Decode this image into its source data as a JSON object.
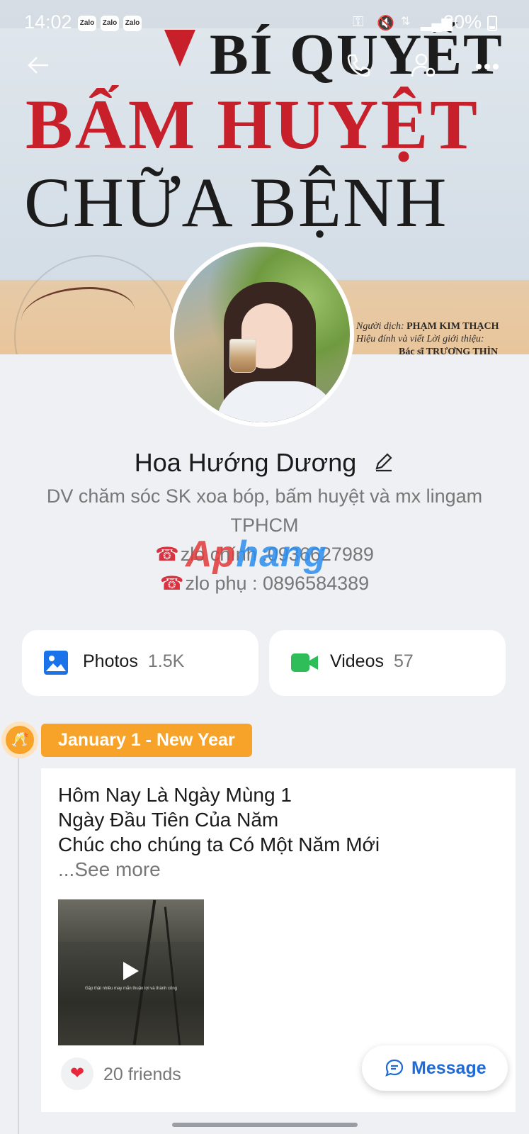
{
  "status_bar": {
    "time": "14:02",
    "notification_icons": [
      "Zalo",
      "Zalo",
      "Zalo"
    ],
    "battery": "20%"
  },
  "cover": {
    "line1": "BÍ QUYẾT",
    "line2": "BẤM HUYỆT",
    "line3": "CHỮA BỆNH",
    "credit_translator_label": "Người dịch:",
    "credit_translator": "PHẠM KIM THẠCH",
    "credit_editor_label": "Hiệu đính và viết Lời giới thiệu:",
    "credit_editor": "Bác sĩ TRƯƠNG THÌN"
  },
  "profile": {
    "name": "Hoa Hướng Dương",
    "bio_line1": "DV chăm sóc SK xoa bóp, bấm huyệt và mx lingam TPHCM",
    "bio_line2": "zlo chính :0936627989",
    "bio_line3": "zlo phụ : 0896584389"
  },
  "watermark": {
    "part1": "Ap",
    "part2": "hang"
  },
  "media": {
    "photos_label": "Photos",
    "photos_count": "1.5K",
    "videos_label": "Videos",
    "videos_count": "57"
  },
  "timeline": {
    "event_tag": "January 1 - New Year",
    "post_line1": "Hôm Nay Là Ngày Mùng 1",
    "post_line2": "Ngày Đầu Tiên Của Năm",
    "post_line3": "Chúc cho chúng ta Có Một Năm Mới",
    "see_more": "...See more",
    "video_caption": "Gặp thật nhiều may mắn thuận lợi và thành công",
    "reaction_count": "20 friends"
  },
  "message_button": "Message",
  "colors": {
    "accent_blue": "#1d6ad8",
    "tag_orange": "#f7a32a",
    "video_green": "#2ebd59",
    "photo_blue": "#1a73e8",
    "heart_red": "#e8283a"
  }
}
